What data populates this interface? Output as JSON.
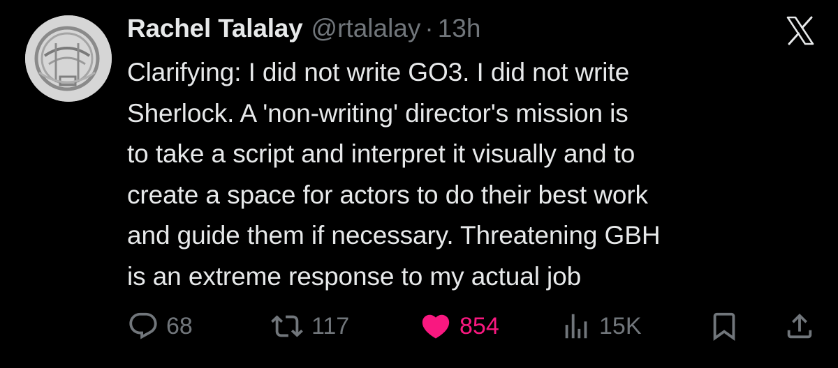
{
  "tweet": {
    "author": {
      "display_name": "Rachel Talalay",
      "handle": "@rtalalay",
      "separator": "·",
      "time": "13h",
      "avatar": "avatar-image"
    },
    "platform_icon": "x-logo-icon",
    "text": "Clarifying: I did not write GO3. I did not write\nSherlock. A 'non-writing' director's mission is\nto take a script and interpret it visually and to\ncreate a space for actors to do their best work\nand guide them if necessary. Threatening GBH\nis an extreme response to my actual job",
    "actions": {
      "reply": {
        "icon": "reply-icon",
        "count": "68"
      },
      "retweet": {
        "icon": "retweet-icon",
        "count": "117"
      },
      "like": {
        "icon": "heart-icon",
        "count": "854",
        "active": true,
        "color": "#f91880"
      },
      "views": {
        "icon": "views-icon",
        "count": "15K"
      },
      "bookmark": {
        "icon": "bookmark-icon"
      },
      "share": {
        "icon": "share-icon"
      }
    }
  },
  "colors": {
    "background": "#000000",
    "text_primary": "#e7e9ea",
    "text_secondary": "#71767b",
    "like_active": "#f91880"
  }
}
